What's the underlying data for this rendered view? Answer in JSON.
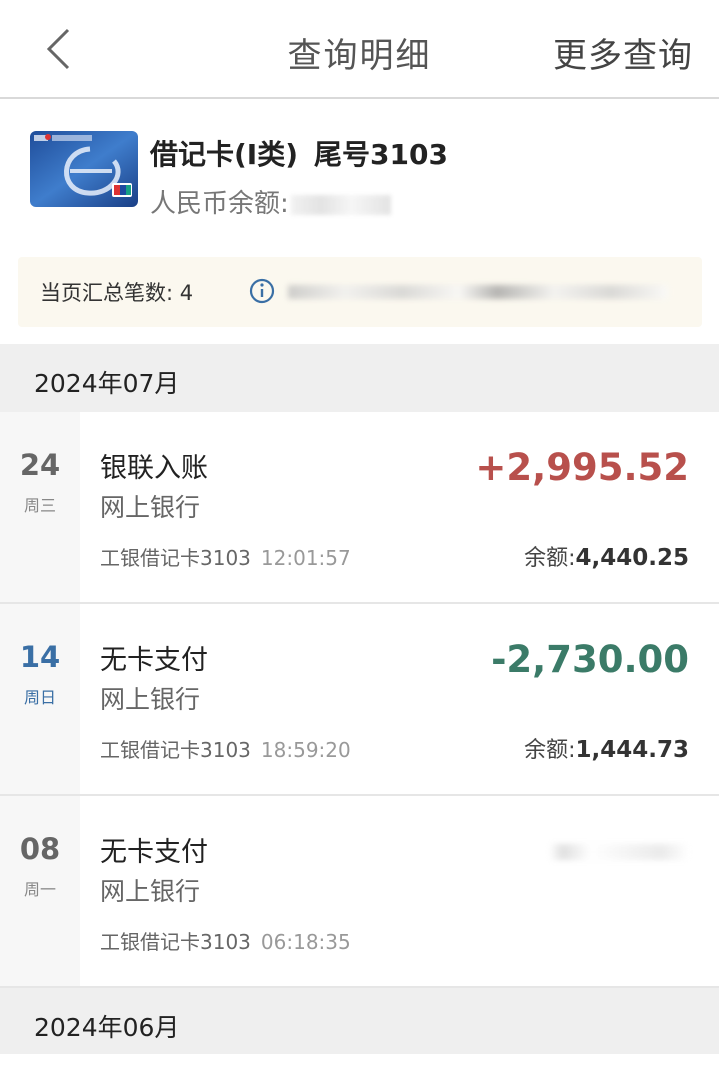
{
  "header": {
    "title": "查询明细",
    "more_label": "更多查询",
    "back_icon": "chevron-left-icon"
  },
  "card": {
    "name": "借记卡(I类)",
    "tail": "尾号3103",
    "balance_label": "人民币余额:",
    "image_icon": "icbc-card-icon"
  },
  "summary": {
    "count_text": "当页汇总笔数: 4",
    "icon": "info-icon"
  },
  "months": [
    {
      "label": "2024年07月"
    },
    {
      "label": "2024年06月"
    }
  ],
  "transactions": [
    {
      "day": "24",
      "weekday": "周三",
      "type": "银联入账",
      "channel": "网上银行",
      "card": "工银借记卡3103",
      "time": "12:01:57",
      "amount": "+2,995.52",
      "direction": "credit",
      "balance_label": "余额:",
      "balance": "4,440.25"
    },
    {
      "day": "14",
      "weekday": "周日",
      "type": "无卡支付",
      "channel": "网上银行",
      "card": "工银借记卡3103",
      "time": "18:59:20",
      "amount": "-2,730.00",
      "direction": "debit",
      "balance_label": "余额:",
      "balance": "1,444.73"
    },
    {
      "day": "08",
      "weekday": "周一",
      "type": "无卡支付",
      "channel": "网上银行",
      "card": "工银借记卡3103",
      "time": "06:18:35"
    }
  ],
  "colors": {
    "credit": "#b8504c",
    "debit": "#3b7b68",
    "weekend_day": "#3a6fa5",
    "month_bg": "#efefef",
    "summary_bg": "#fbf8ef"
  }
}
